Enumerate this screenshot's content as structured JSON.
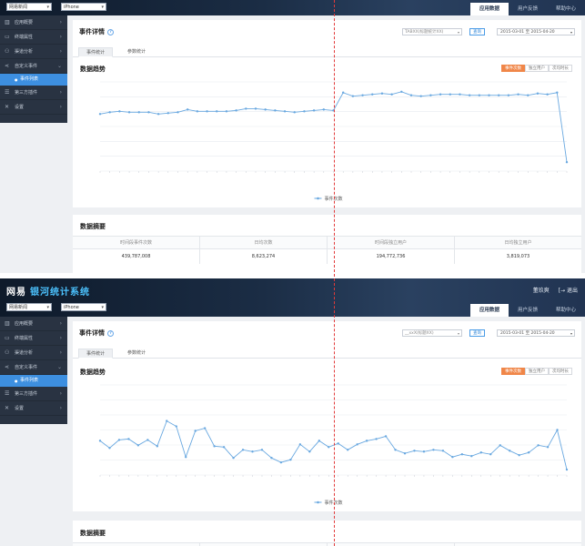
{
  "accent_color": "#3d8fe0",
  "active_button_color": "#f08648",
  "guide_line_color": "#e23a3a",
  "header": {
    "brand": "网易",
    "brand_sub": "银河统计系统",
    "user": "董玖爽",
    "logout": "退出",
    "app_select": "网易新闻",
    "device_select": "iPhone",
    "tabs": [
      "应用数据",
      "用户反馈",
      "帮助中心"
    ]
  },
  "sidebar": {
    "items": [
      {
        "label": "应用概要",
        "icon": "bar-chart-icon"
      },
      {
        "label": "终端属性",
        "icon": "device-icon"
      },
      {
        "label": "渠道分析",
        "icon": "network-icon"
      },
      {
        "label": "自定义事件",
        "icon": "share-icon"
      },
      {
        "label": "事件列表",
        "icon": "bullet-icon"
      },
      {
        "label": "第三方插件",
        "icon": "list-icon"
      },
      {
        "label": "设置",
        "icon": "tools-icon"
      }
    ]
  },
  "event_detail": {
    "title": "事件详情",
    "help": "?",
    "event_select_top": "TABXX(标题统计XX)",
    "event_select_bottom": "__xxX(标题XX)",
    "query_button": "查询",
    "date_range": "2015-03-01 至 2015-04-20",
    "tabs": [
      "事件统计",
      "参数统计"
    ]
  },
  "trend": {
    "title": "数据趋势",
    "buttons": [
      "事件次数",
      "独立用户",
      "次均时长"
    ]
  },
  "chart_data": [
    {
      "type": "line",
      "series": [
        {
          "name": "事件次数",
          "values": [
            64,
            66,
            67,
            66,
            66,
            66,
            64,
            65,
            66,
            69,
            67,
            67,
            67,
            67,
            68,
            70,
            70,
            69,
            68,
            67,
            66,
            67,
            68,
            69,
            68,
            88,
            84,
            85,
            86,
            87,
            86,
            89,
            85,
            84,
            85,
            86,
            86,
            86,
            85,
            85,
            85,
            85,
            85,
            86,
            85,
            87,
            86,
            88,
            10
          ]
        }
      ],
      "xlabel": "",
      "ylabel": ""
    },
    {
      "type": "line",
      "series": [
        {
          "name": "事件次数",
          "values": [
            38,
            30,
            39,
            40,
            33,
            39,
            32,
            60,
            54,
            20,
            49,
            52,
            32,
            31,
            19,
            28,
            26,
            28,
            19,
            14,
            17,
            34,
            26,
            38,
            31,
            35,
            28,
            34,
            38,
            40,
            43,
            28,
            24,
            27,
            26,
            28,
            27,
            20,
            23,
            21,
            25,
            23,
            33,
            27,
            22,
            25,
            33,
            31,
            50,
            6
          ]
        }
      ],
      "xlabel": "",
      "ylabel": ""
    }
  ],
  "summary": {
    "title": "数据摘要",
    "headers": [
      "时间段事件次数",
      "日均次数",
      "时间段独立用户",
      "日均独立用户"
    ],
    "values": [
      "439,787,008",
      "8,623,274",
      "194,772,736",
      "3,819,073"
    ]
  }
}
